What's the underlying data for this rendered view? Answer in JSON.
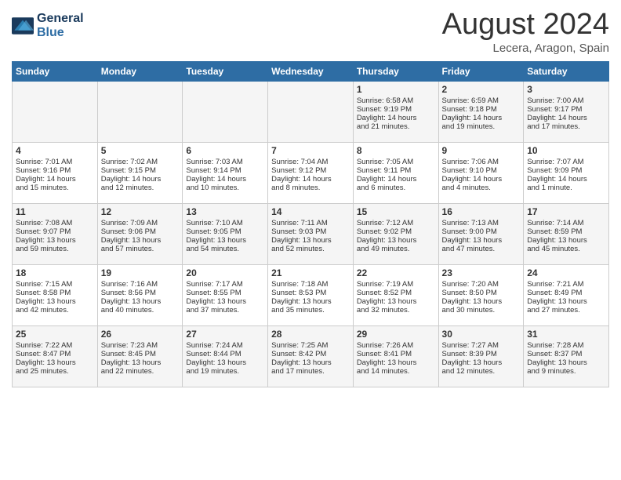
{
  "header": {
    "logo_line1": "General",
    "logo_line2": "Blue",
    "month": "August 2024",
    "location": "Lecera, Aragon, Spain"
  },
  "days_of_week": [
    "Sunday",
    "Monday",
    "Tuesday",
    "Wednesday",
    "Thursday",
    "Friday",
    "Saturday"
  ],
  "weeks": [
    [
      {
        "day": "",
        "content": ""
      },
      {
        "day": "",
        "content": ""
      },
      {
        "day": "",
        "content": ""
      },
      {
        "day": "",
        "content": ""
      },
      {
        "day": "1",
        "content": "Sunrise: 6:58 AM\nSunset: 9:19 PM\nDaylight: 14 hours\nand 21 minutes."
      },
      {
        "day": "2",
        "content": "Sunrise: 6:59 AM\nSunset: 9:18 PM\nDaylight: 14 hours\nand 19 minutes."
      },
      {
        "day": "3",
        "content": "Sunrise: 7:00 AM\nSunset: 9:17 PM\nDaylight: 14 hours\nand 17 minutes."
      }
    ],
    [
      {
        "day": "4",
        "content": "Sunrise: 7:01 AM\nSunset: 9:16 PM\nDaylight: 14 hours\nand 15 minutes."
      },
      {
        "day": "5",
        "content": "Sunrise: 7:02 AM\nSunset: 9:15 PM\nDaylight: 14 hours\nand 12 minutes."
      },
      {
        "day": "6",
        "content": "Sunrise: 7:03 AM\nSunset: 9:14 PM\nDaylight: 14 hours\nand 10 minutes."
      },
      {
        "day": "7",
        "content": "Sunrise: 7:04 AM\nSunset: 9:12 PM\nDaylight: 14 hours\nand 8 minutes."
      },
      {
        "day": "8",
        "content": "Sunrise: 7:05 AM\nSunset: 9:11 PM\nDaylight: 14 hours\nand 6 minutes."
      },
      {
        "day": "9",
        "content": "Sunrise: 7:06 AM\nSunset: 9:10 PM\nDaylight: 14 hours\nand 4 minutes."
      },
      {
        "day": "10",
        "content": "Sunrise: 7:07 AM\nSunset: 9:09 PM\nDaylight: 14 hours\nand 1 minute."
      }
    ],
    [
      {
        "day": "11",
        "content": "Sunrise: 7:08 AM\nSunset: 9:07 PM\nDaylight: 13 hours\nand 59 minutes."
      },
      {
        "day": "12",
        "content": "Sunrise: 7:09 AM\nSunset: 9:06 PM\nDaylight: 13 hours\nand 57 minutes."
      },
      {
        "day": "13",
        "content": "Sunrise: 7:10 AM\nSunset: 9:05 PM\nDaylight: 13 hours\nand 54 minutes."
      },
      {
        "day": "14",
        "content": "Sunrise: 7:11 AM\nSunset: 9:03 PM\nDaylight: 13 hours\nand 52 minutes."
      },
      {
        "day": "15",
        "content": "Sunrise: 7:12 AM\nSunset: 9:02 PM\nDaylight: 13 hours\nand 49 minutes."
      },
      {
        "day": "16",
        "content": "Sunrise: 7:13 AM\nSunset: 9:00 PM\nDaylight: 13 hours\nand 47 minutes."
      },
      {
        "day": "17",
        "content": "Sunrise: 7:14 AM\nSunset: 8:59 PM\nDaylight: 13 hours\nand 45 minutes."
      }
    ],
    [
      {
        "day": "18",
        "content": "Sunrise: 7:15 AM\nSunset: 8:58 PM\nDaylight: 13 hours\nand 42 minutes."
      },
      {
        "day": "19",
        "content": "Sunrise: 7:16 AM\nSunset: 8:56 PM\nDaylight: 13 hours\nand 40 minutes."
      },
      {
        "day": "20",
        "content": "Sunrise: 7:17 AM\nSunset: 8:55 PM\nDaylight: 13 hours\nand 37 minutes."
      },
      {
        "day": "21",
        "content": "Sunrise: 7:18 AM\nSunset: 8:53 PM\nDaylight: 13 hours\nand 35 minutes."
      },
      {
        "day": "22",
        "content": "Sunrise: 7:19 AM\nSunset: 8:52 PM\nDaylight: 13 hours\nand 32 minutes."
      },
      {
        "day": "23",
        "content": "Sunrise: 7:20 AM\nSunset: 8:50 PM\nDaylight: 13 hours\nand 30 minutes."
      },
      {
        "day": "24",
        "content": "Sunrise: 7:21 AM\nSunset: 8:49 PM\nDaylight: 13 hours\nand 27 minutes."
      }
    ],
    [
      {
        "day": "25",
        "content": "Sunrise: 7:22 AM\nSunset: 8:47 PM\nDaylight: 13 hours\nand 25 minutes."
      },
      {
        "day": "26",
        "content": "Sunrise: 7:23 AM\nSunset: 8:45 PM\nDaylight: 13 hours\nand 22 minutes."
      },
      {
        "day": "27",
        "content": "Sunrise: 7:24 AM\nSunset: 8:44 PM\nDaylight: 13 hours\nand 19 minutes."
      },
      {
        "day": "28",
        "content": "Sunrise: 7:25 AM\nSunset: 8:42 PM\nDaylight: 13 hours\nand 17 minutes."
      },
      {
        "day": "29",
        "content": "Sunrise: 7:26 AM\nSunset: 8:41 PM\nDaylight: 13 hours\nand 14 minutes."
      },
      {
        "day": "30",
        "content": "Sunrise: 7:27 AM\nSunset: 8:39 PM\nDaylight: 13 hours\nand 12 minutes."
      },
      {
        "day": "31",
        "content": "Sunrise: 7:28 AM\nSunset: 8:37 PM\nDaylight: 13 hours\nand 9 minutes."
      }
    ]
  ]
}
